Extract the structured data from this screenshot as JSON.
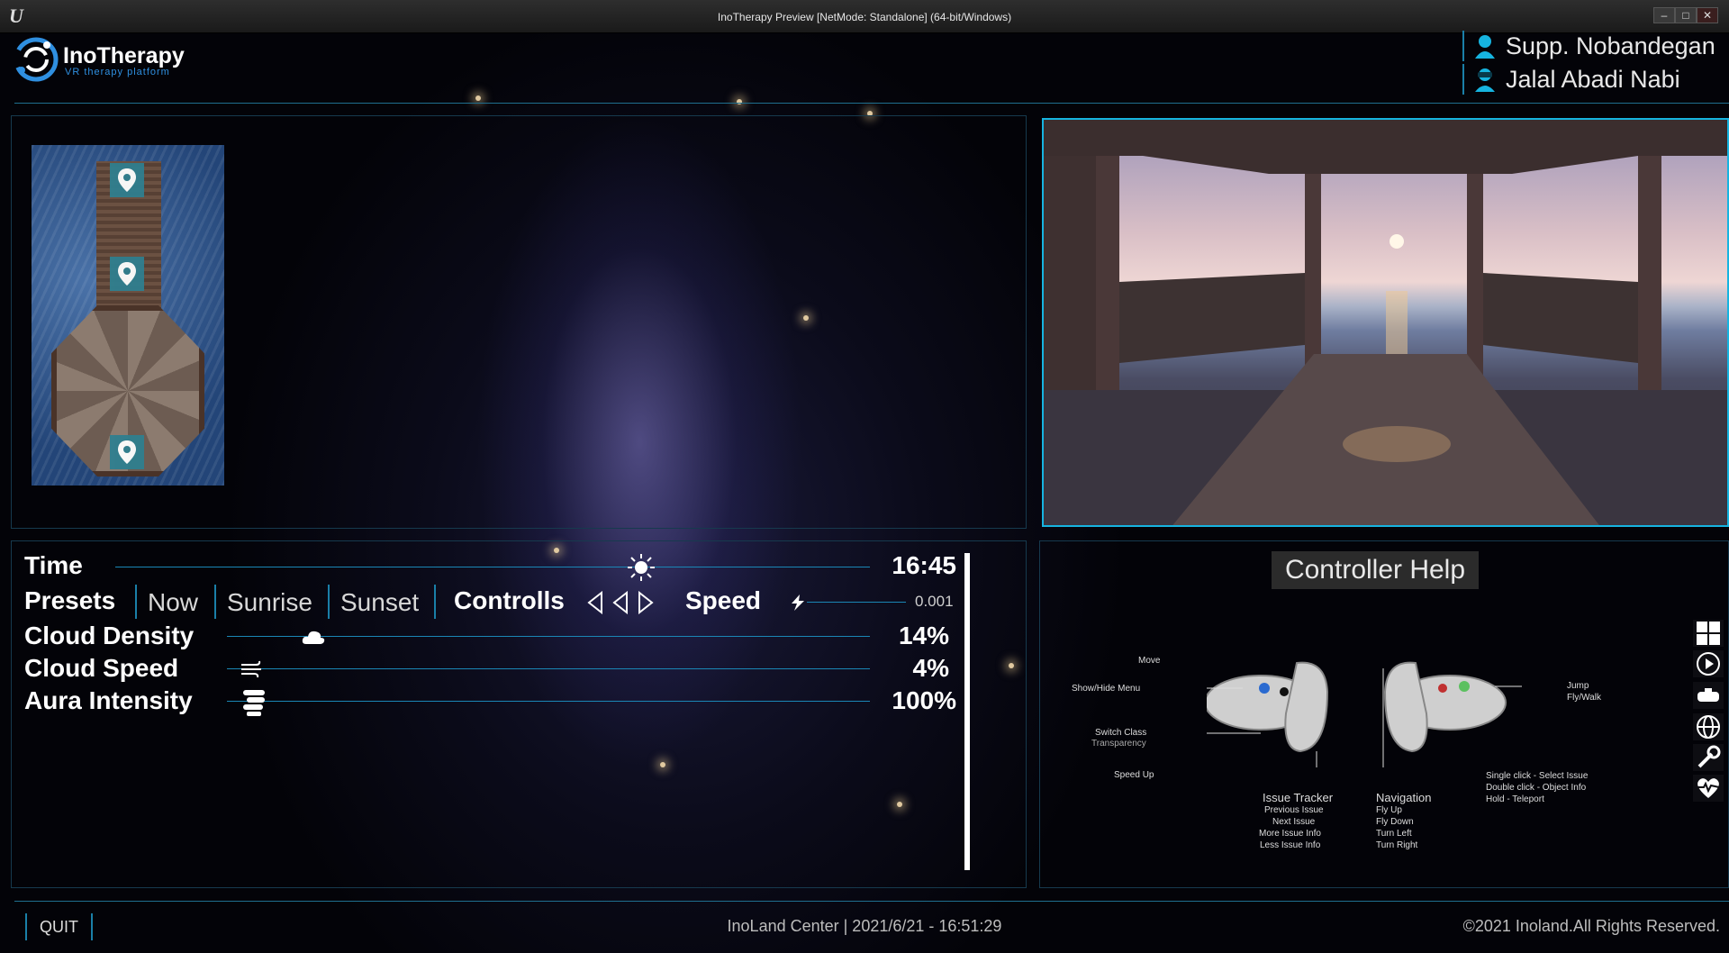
{
  "window": {
    "title": "InoTherapy Preview [NetMode: Standalone]  (64-bit/Windows)",
    "engine_logo": "U",
    "buttons": [
      "–",
      "□",
      "✕"
    ]
  },
  "brand": {
    "name": "InoTherapy",
    "tagline": "VR therapy platform",
    "accent": "#16b4e0"
  },
  "users": [
    {
      "name": "Supp. Nobandegan",
      "icon": "user-female-icon"
    },
    {
      "name": "Jalal Abadi Nabi",
      "icon": "user-vr-icon"
    }
  ],
  "controls": {
    "time": {
      "label": "Time",
      "value": "16:45",
      "icon": "sun-icon"
    },
    "presets": {
      "label": "Presets",
      "options": [
        "Now",
        "Sunrise",
        "Sunset"
      ]
    },
    "controlls": {
      "label": "Controlls",
      "icons": [
        "step-back-icon",
        "back-icon",
        "play-icon"
      ]
    },
    "speed": {
      "label": "Speed",
      "value": "0.001",
      "icon": "lightning-icon"
    },
    "cloud_density": {
      "label": "Cloud Density",
      "value": "14%",
      "level": 0.14,
      "icon": "cloud-icon"
    },
    "cloud_speed": {
      "label": "Cloud Speed",
      "value": "4%",
      "level": 0.04,
      "icon": "wind-icon"
    },
    "aura_intensity": {
      "label": "Aura Intensity",
      "value": "100%",
      "level": 1.0,
      "icon": "aura-icon"
    }
  },
  "help": {
    "title": "Controller Help",
    "left_labels": [
      "Move",
      "Show/Hide Menu",
      "Switch Class",
      "Transparency",
      "Speed Up"
    ],
    "right_labels": [
      "Jump",
      "Fly/Walk"
    ],
    "issue_tracker": {
      "title": "Issue Tracker",
      "items": [
        "Previous Issue",
        "Next Issue",
        "More Issue Info",
        "Less Issue Info"
      ]
    },
    "navigation": {
      "title": "Navigation",
      "items": [
        "Fly Up",
        "Fly Down",
        "Turn Left",
        "Turn Right"
      ]
    },
    "click_help": [
      "Single click - Select Issue",
      "Double click - Object Info",
      "Hold - Teleport"
    ]
  },
  "side_icons": [
    "dashboard-icon",
    "play-circle-icon",
    "vr-headset-icon",
    "globe-icon",
    "tools-icon",
    "heart-pulse-icon"
  ],
  "footer": {
    "quit": "QUIT",
    "center": "InoLand Center | 2021/6/21 - 16:51:29",
    "copyright": "©2021 Inoland.All Rights Reserved."
  }
}
